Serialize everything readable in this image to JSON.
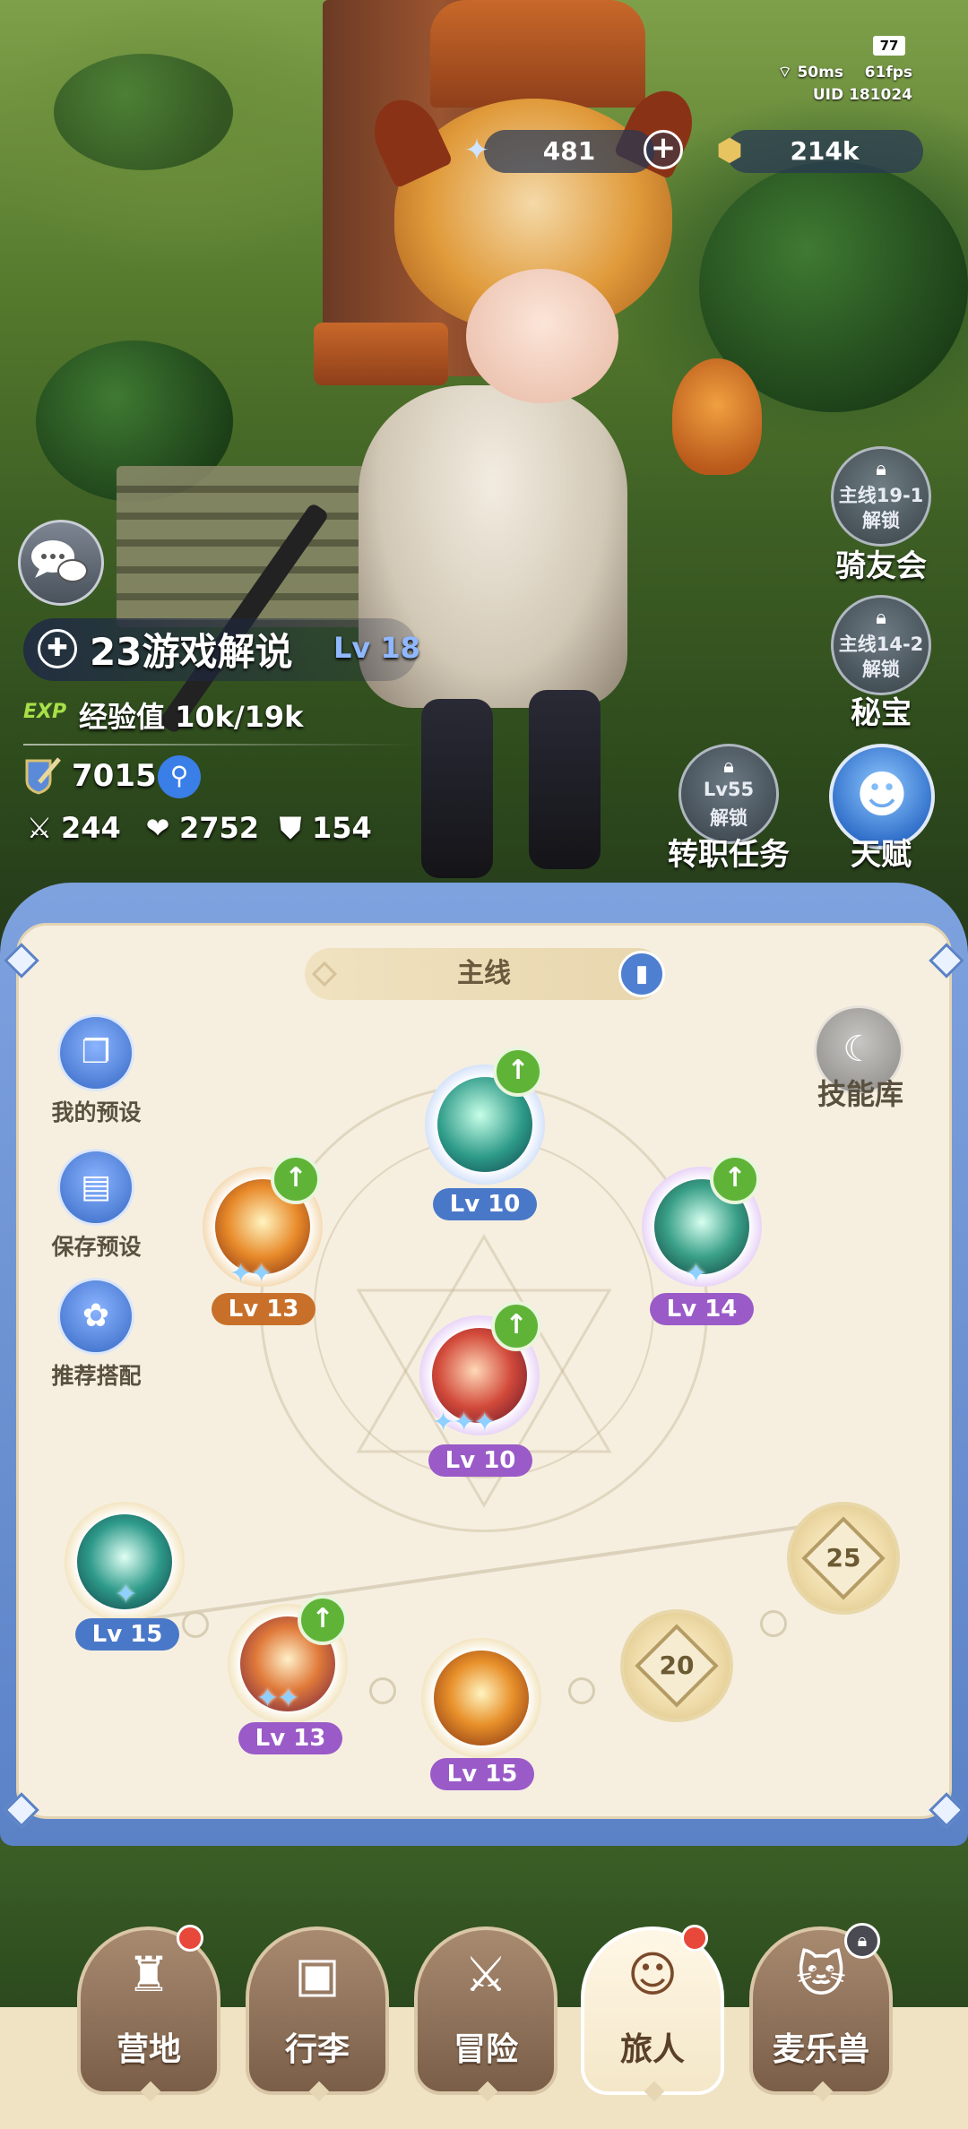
{
  "status": {
    "battery": "77",
    "ping": "50ms",
    "fps": "61fps",
    "uid": "UID 181024"
  },
  "currency": {
    "gems": "481",
    "gold": "214k",
    "gem_icon": "star-crystal-icon",
    "gold_icon": "gold-coin-icon"
  },
  "player": {
    "name": "23游戏解说",
    "level": "Lv 18",
    "exp_tag": "EXP",
    "exp_text": "经验值 10k/19k",
    "power": "7015",
    "attack": "244",
    "health": "2752",
    "defense": "154"
  },
  "side_buttons": [
    {
      "lock_line1": "主线19-1",
      "lock_line2": "解锁",
      "label": "骑友会"
    },
    {
      "lock_line1": "主线14-2",
      "lock_line2": "解锁",
      "label": "秘宝"
    },
    {
      "lock_line1": "Lv55",
      "lock_line2": "解锁",
      "label": "转职任务"
    },
    {
      "label": "天赋"
    }
  ],
  "panel": {
    "tab": "主线",
    "left_actions": [
      "我的预设",
      "保存预设",
      "推荐搭配"
    ],
    "library": "技能库",
    "skills": [
      {
        "level": "Lv 10"
      },
      {
        "level": "Lv 13"
      },
      {
        "level": "Lv 14"
      },
      {
        "level": "Lv 10"
      },
      {
        "level": "Lv 15"
      },
      {
        "level": "Lv 13"
      },
      {
        "level": "Lv 15"
      }
    ],
    "unlock_slots": [
      "20",
      "25"
    ]
  },
  "nav": [
    {
      "label": "营地",
      "icon": "castle-icon"
    },
    {
      "label": "行李",
      "icon": "backpack-icon"
    },
    {
      "label": "冒险",
      "icon": "crossed-swords-icon"
    },
    {
      "label": "旅人",
      "icon": "traveler-avatar-icon"
    },
    {
      "label": "麦乐兽",
      "icon": "cat-pet-icon"
    }
  ],
  "colors": {
    "panel_blue": "#5b82c6",
    "upgrade_green": "#5fb438",
    "lv_orange": "#c8702a",
    "lv_blue": "#4a78c8",
    "lv_purple": "#9a5ac8",
    "notify_red": "#e8483a"
  }
}
